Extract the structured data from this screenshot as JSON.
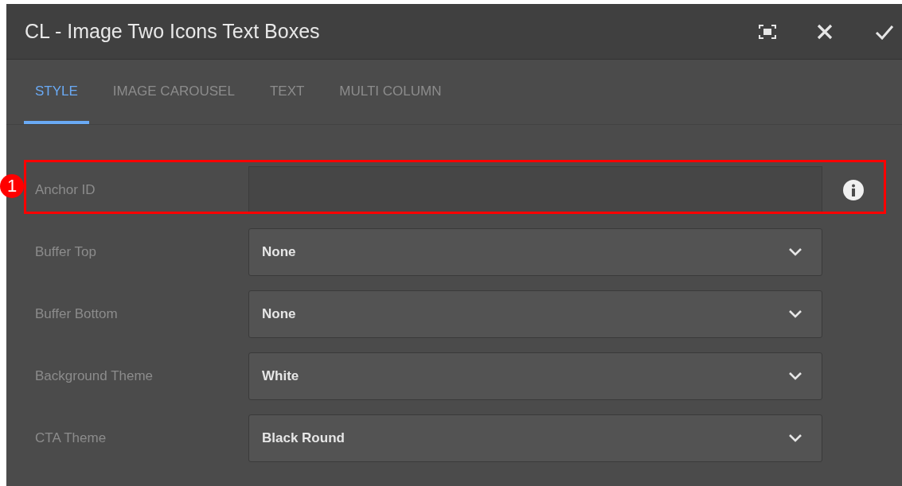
{
  "window": {
    "title": "CL - Image Two Icons Text Boxes"
  },
  "tabs": [
    {
      "label": "STYLE",
      "selected": true
    },
    {
      "label": "IMAGE CAROUSEL",
      "selected": false
    },
    {
      "label": "TEXT",
      "selected": false
    },
    {
      "label": "MULTI COLUMN",
      "selected": false
    }
  ],
  "fields": [
    {
      "kind": "text",
      "label": "Anchor ID",
      "info": true,
      "annotation": "1"
    },
    {
      "kind": "select",
      "label": "Buffer Top",
      "value": "None"
    },
    {
      "kind": "select",
      "label": "Buffer Bottom",
      "value": "None"
    },
    {
      "kind": "select",
      "label": "Background Theme",
      "value": "White"
    },
    {
      "kind": "select",
      "label": "CTA Theme",
      "value": "Black Round"
    }
  ]
}
